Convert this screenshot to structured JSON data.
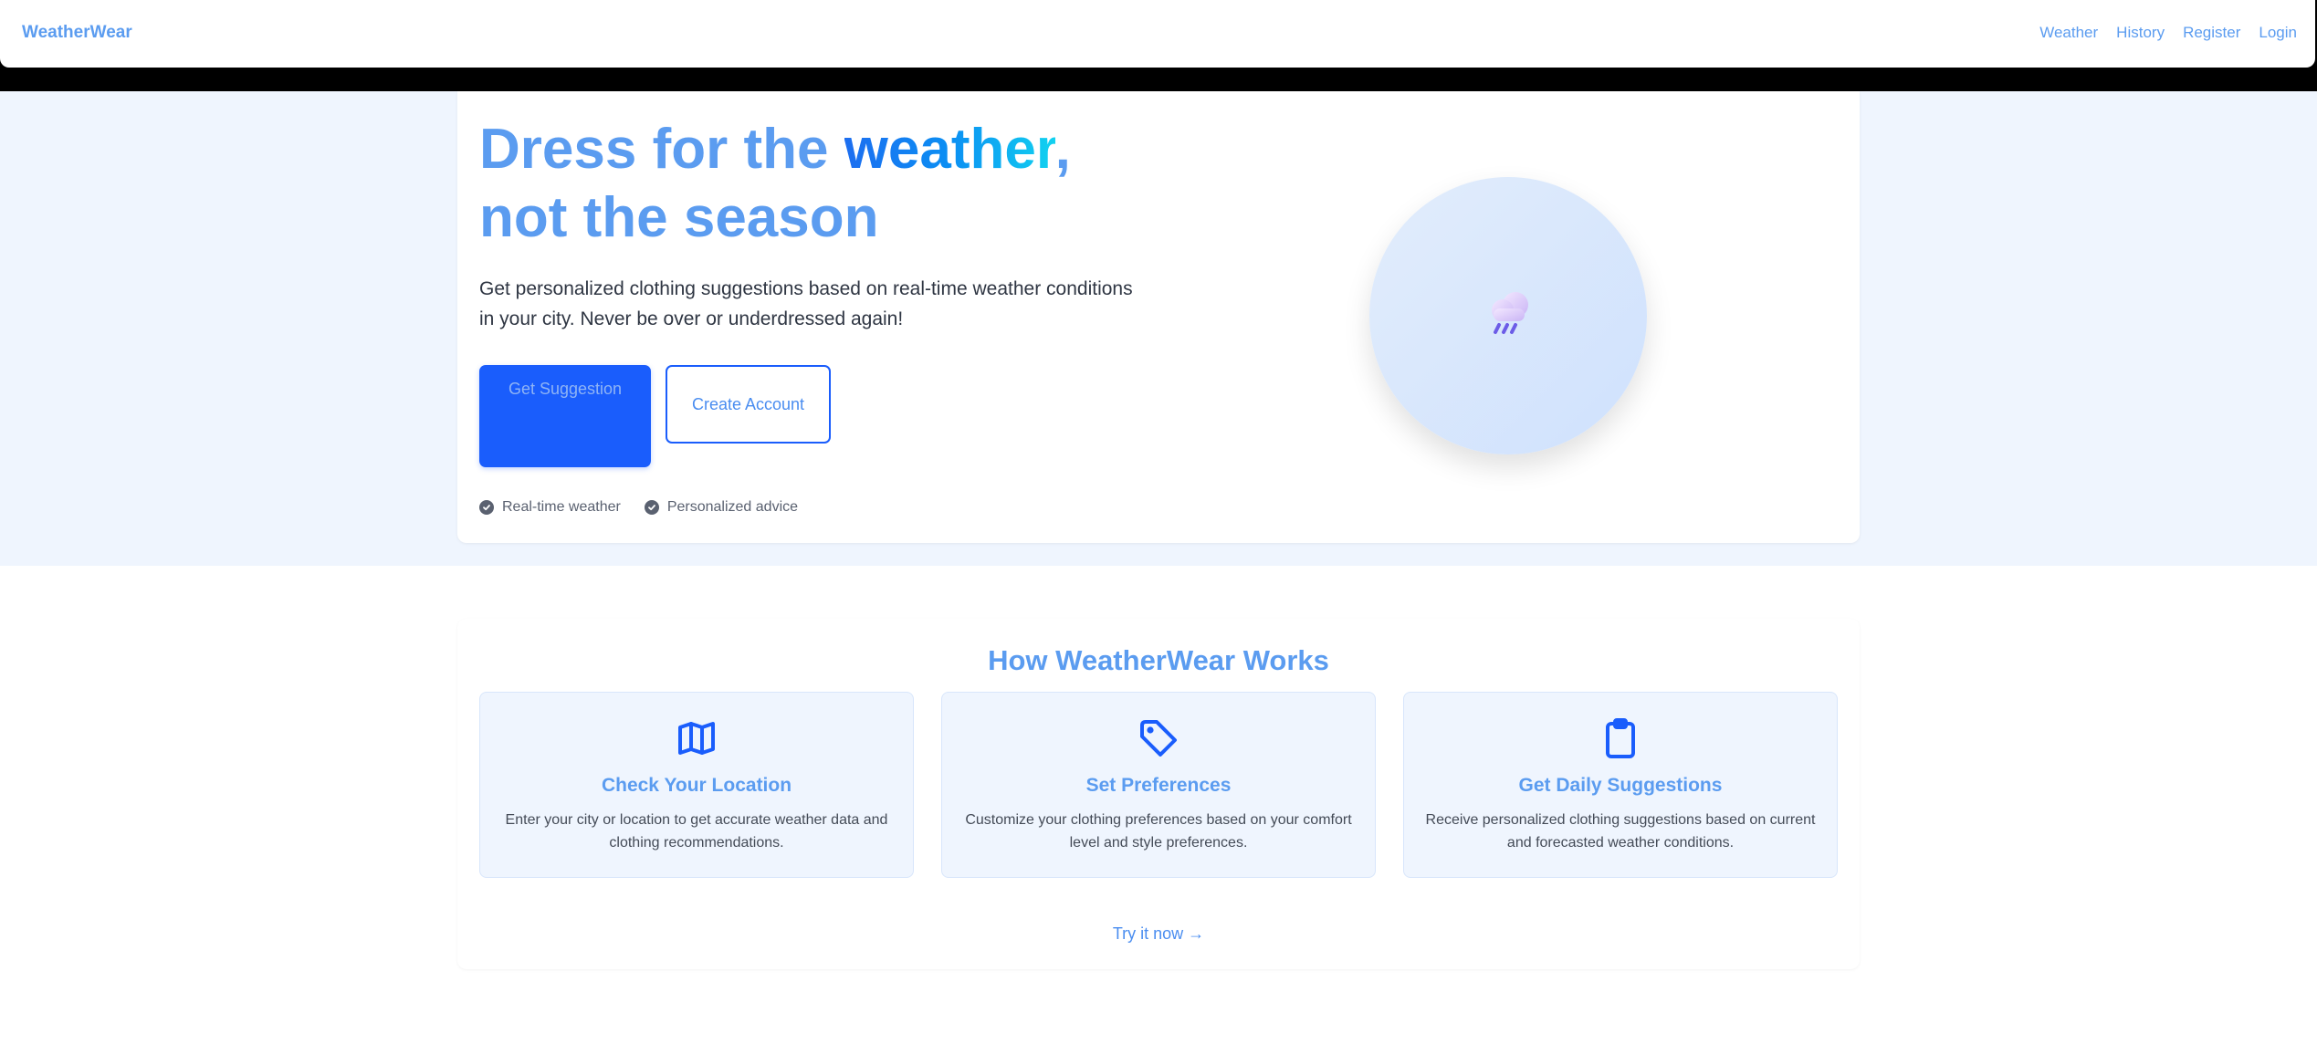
{
  "brand": "WeatherWear",
  "nav": {
    "weather": "Weather",
    "history": "History",
    "register": "Register",
    "login": "Login"
  },
  "hero": {
    "headline_part1": "Dress for the ",
    "headline_accent": "weather",
    "headline_part2": ",",
    "headline_line2": "not the season",
    "description": "Get personalized clothing suggestions based on real-time weather conditions in your city. Never be over or underdressed again!",
    "primary_button": "Get Suggestion",
    "secondary_button": "Create Account",
    "badges": [
      "Real-time weather",
      "Personalized advice"
    ],
    "weather_icon": "rain-cloud-icon"
  },
  "how": {
    "title": "How WeatherWear Works",
    "features": [
      {
        "icon": "map-icon",
        "title": "Check Your Location",
        "description": "Enter your city or location to get accurate weather data and clothing recommendations."
      },
      {
        "icon": "tag-icon",
        "title": "Set Preferences",
        "description": "Customize your clothing preferences based on your comfort level and style preferences."
      },
      {
        "icon": "clipboard-icon",
        "title": "Get Daily Suggestions",
        "description": "Receive personalized clothing suggestions based on current and forecasted weather conditions."
      }
    ],
    "cta": "Try it now →"
  },
  "colors": {
    "accent": "#5b9cf0",
    "primary": "#1a5dfc",
    "background": "#eff5fe"
  }
}
